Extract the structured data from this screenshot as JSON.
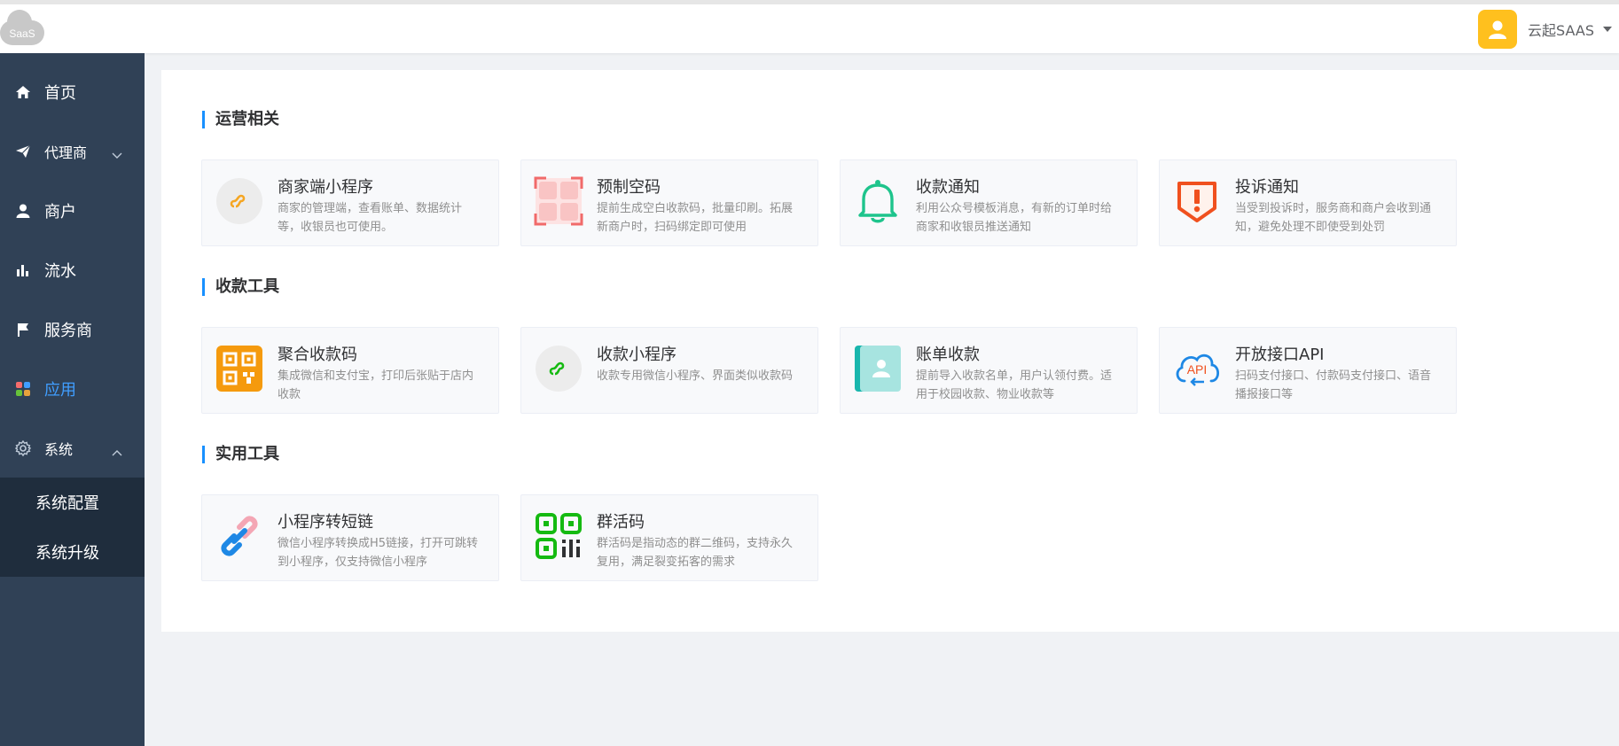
{
  "header": {
    "logo_text": "SaaS",
    "username": "云起SAAS"
  },
  "sidebar": {
    "items": [
      {
        "label": "首页",
        "icon": "home-icon"
      },
      {
        "label": "代理商",
        "icon": "paper-plane-icon"
      },
      {
        "label": "商户",
        "icon": "user-icon"
      },
      {
        "label": "流水",
        "icon": "bar-chart-icon"
      },
      {
        "label": "服务商",
        "icon": "flag-icon"
      },
      {
        "label": "应用",
        "icon": "apps-grid-icon",
        "active": true
      },
      {
        "label": "系统",
        "icon": "gear-icon"
      }
    ],
    "system_sub": [
      {
        "label": "系统配置"
      },
      {
        "label": "系统升级"
      }
    ]
  },
  "sections": [
    {
      "title": "运营相关",
      "cards": [
        {
          "title": "商家端小程序",
          "desc": "商家的管理端，查看账单、数据统计等，收银员也可使用。",
          "icon": "mini-program-icon"
        },
        {
          "title": "预制空码",
          "desc": "提前生成空白收款码，批量印刷。拓展新商户时，扫码绑定即可使用",
          "icon": "blank-code-icon"
        },
        {
          "title": "收款通知",
          "desc": "利用公众号模板消息，有新的订单时给商家和收银员推送通知",
          "icon": "bell-icon"
        },
        {
          "title": "投诉通知",
          "desc": "当受到投诉时，服务商和商户会收到通知，避免处理不即使受到处罚",
          "icon": "complaint-shield-icon"
        }
      ]
    },
    {
      "title": "收款工具",
      "cards": [
        {
          "title": "聚合收款码",
          "desc": "集成微信和支付宝，打印后张贴于店内收款",
          "icon": "qrcode-icon"
        },
        {
          "title": "收款小程序",
          "desc": "收款专用微信小程序、界面类似收款码",
          "icon": "mini-program-green-icon"
        },
        {
          "title": "账单收款",
          "desc": "提前导入收款名单，用户认领付费。适用于校园收款、物业收款等",
          "icon": "contact-book-icon"
        },
        {
          "title": "开放接口API",
          "desc": "扫码支付接口、付款码支付接口、语音播报接口等",
          "icon": "api-cloud-icon"
        }
      ]
    },
    {
      "title": "实用工具",
      "cards": [
        {
          "title": "小程序转短链",
          "desc": "微信小程序转换成H5链接，打开可跳转到小程序，仅支持微信小程序",
          "icon": "link-icon"
        },
        {
          "title": "群活码",
          "desc": "群活码是指动态的群二维码，支持永久复用，满足裂变拓客的需求",
          "icon": "group-qrcode-icon"
        }
      ]
    }
  ],
  "colors": {
    "sidebar_bg": "#304156",
    "submenu_bg": "#1f2d3d",
    "active": "#409eff",
    "section_bar": "#1890ff"
  }
}
